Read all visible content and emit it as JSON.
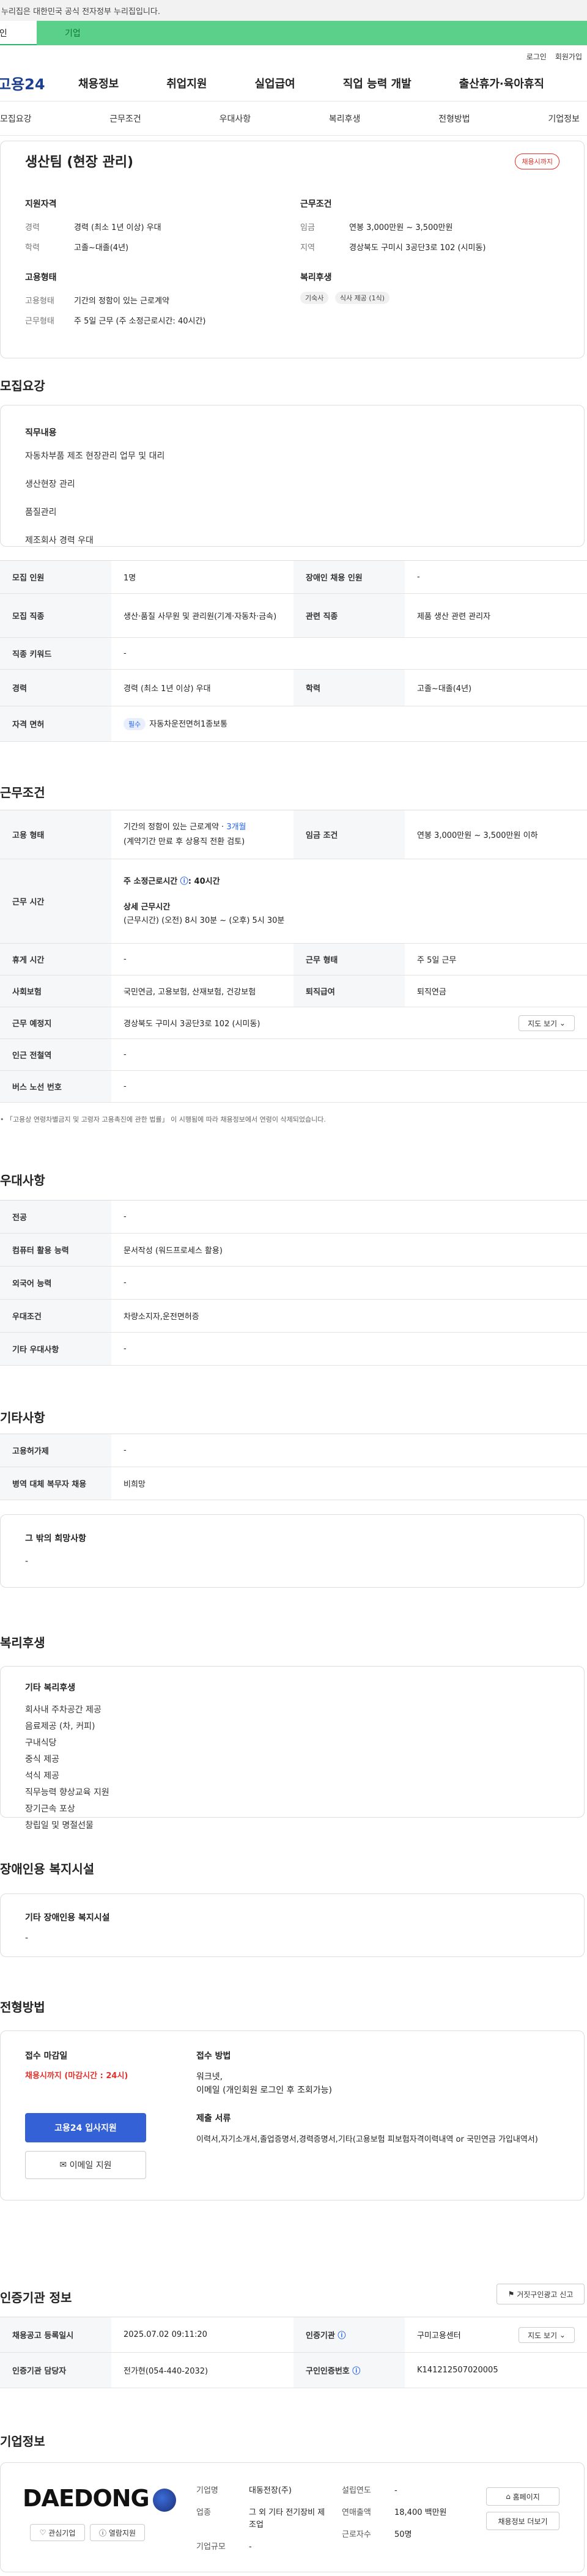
{
  "gov_banner": "이 누리집은 대한민국 공식 전자정부 누리집입니다.",
  "type_tabs": [
    "개인",
    "기업"
  ],
  "top_links": [
    "로그인",
    "회원가입"
  ],
  "gnb": {
    "logo": "고용24",
    "menu": [
      "채용정보",
      "취업지원",
      "실업급여",
      "직업 능력 개발",
      "출산휴가·육아휴직"
    ]
  },
  "subnav": [
    "모집요강",
    "근무조건",
    "우대사항",
    "복리후생",
    "전형방법",
    "기업정보"
  ],
  "summary": {
    "title": "생산팀 (현장 관리)",
    "deadline_badge": "채용시까지",
    "qual_head": "지원자격",
    "career_k": "경력",
    "career_v": "경력 (최소 1년 이상) 우대",
    "edu_k": "학력",
    "edu_v": "고졸~대졸(4년)",
    "emp_head": "고용형태",
    "emptype_k": "고용형태",
    "emptype_v": "기간의 정함이 있는 근로계약",
    "worktype_k": "근무형태",
    "worktype_v": "주 5일 근무 (주 소정근로시간: 40시간)",
    "cond_head": "근무조건",
    "wage_k": "임금",
    "wage_v": "연봉 3,000만원 ~ 3,500만원",
    "area_k": "지역",
    "area_v": "경상북도 구미시 3공단3로 102 (시미동)",
    "welfare_head": "복리후생",
    "welfare_tags": [
      "기숙사",
      "식사 제공 (1식)"
    ]
  },
  "recruit": {
    "heading": "모집요강",
    "duty_label": "직무내용",
    "duties": [
      "자동차부품 제조 현장관리 업무 및 대리",
      "생산현장 관리",
      "품질관리",
      "제조회사 경력 우대"
    ],
    "table": [
      {
        "k1": "모집 인원",
        "v1": "1명",
        "k2": "장애인 채용 인원",
        "v2": "-"
      },
      {
        "k1": "모집 직종",
        "v1": "생산·품질 사무원 및 관리원(기계·자동차·금속)",
        "k2": "관련 직종",
        "v2": "제품 생산 관련 관리자"
      },
      {
        "k1": "직종 키워드",
        "v1": "-"
      },
      {
        "k1": "경력",
        "v1": "경력 (최소 1년 이상) 우대",
        "k2": "학력",
        "v2": "고졸~대졸(4년)"
      },
      {
        "k1": "자격 면허",
        "v1": "자동차운전면허1종보통",
        "tag": "필수"
      }
    ]
  },
  "work": {
    "heading": "근무조건",
    "emp_k": "고용 형태",
    "emp_v1": "기간의 정함이 있는 근로계약 · ",
    "emp_v1b": "3개월",
    "emp_v2": "(계약기간 만료 후 상용직 전환 검토)",
    "wage_k": "임금 조건",
    "wage_v": "연봉 3,000만원 ~ 3,500만원 이하",
    "time_k": "근무 시간",
    "time_main": "주 소정근로시간 ",
    "time_main2": ": 40시간",
    "time_detail_label": "상세 근무시간",
    "time_detail": "(근무시간) (오전) 8시 30분 ~ (오후) 5시 30분",
    "rest_k": "휴게 시간",
    "rest_v": "-",
    "form_k": "근무 형태",
    "form_v": "주 5일 근무",
    "ins_k": "사회보험",
    "ins_v": "국민연금, 고용보험, 산재보험, 건강보험",
    "ret_k": "퇴직급여",
    "ret_v": "퇴직연금",
    "loc_k": "근무 예정지",
    "loc_v": "경상북도 구미시 3공단3로 102 (시미동)",
    "map_btn": "지도 보기",
    "subway_k": "인근 전철역",
    "subway_v": "-",
    "bus_k": "버스 노선 번호",
    "bus_v": "-",
    "notice": "「고용상 연령차별금지 및 고령자 고용촉진에 관한 법률」 이 시행됨에 따라 채용정보에서 연령이 삭제되었습니다."
  },
  "pref": {
    "heading": "우대사항",
    "rows": [
      {
        "k": "전공",
        "v": "-"
      },
      {
        "k": "컴퓨터 활용 능력",
        "v": "문서작성 (워드프로세스 활용)"
      },
      {
        "k": "외국어 능력",
        "v": "-"
      },
      {
        "k": "우대조건",
        "v": "차량소지자,운전면허증"
      },
      {
        "k": "기타 우대사항",
        "v": "-"
      }
    ]
  },
  "etc": {
    "heading": "기타사항",
    "rows": [
      {
        "k": "고용허가제",
        "v": "-"
      },
      {
        "k": "병역 대체 복무자 채용",
        "v": "비희망"
      }
    ],
    "box_title": "그 밖의 희망사항",
    "box_value": "-"
  },
  "welfare": {
    "heading": "복리후생",
    "box_title": "기타 복리후생",
    "items": [
      "회사내 주차공간 제공",
      "음료제공 (차, 커피)",
      "구내식당",
      "중식 제공",
      "석식 제공",
      "직무능력 향상교육 지원",
      "장기근속 포상",
      "창립일 및 명절선물"
    ]
  },
  "disabled": {
    "heading": "장애인용 복지시설",
    "box_title": "기타 장애인용 복지시설",
    "box_value": "-"
  },
  "process": {
    "heading": "전형방법",
    "deadline_label": "접수 마감일",
    "deadline_value": "채용시까지 (마감시간 : 24시)",
    "apply_btn": "고용24 입사지원",
    "email_btn": "이메일 지원",
    "method_label": "접수 방법",
    "methods": [
      "워크넷,",
      "이메일 (개인회원 로그인 후 조회가능)"
    ],
    "docs_label": "제출 서류",
    "docs": "이력서,자기소개서,졸업증명서,경력증명서,기타(고용보험 피보험자격이력내역 or 국민연금 가입내역서)"
  },
  "auth": {
    "heading": "인증기관 정보",
    "report_btn": "거짓구인광고 신고",
    "reg_k": "채용공고 등록일시",
    "reg_v": "2025.07.02 09:11:20",
    "org_k": "인증기관",
    "org_v": "구미고용센터",
    "map_btn": "지도 보기",
    "mgr_k": "인증기관 담당자",
    "mgr_v": "전가현(054-440-2032)",
    "num_k": "구인인증번호",
    "num_v": "K141212507020005"
  },
  "company": {
    "heading": "기업정보",
    "logo_text": "DAEDONG",
    "interest_btn": "관심기업",
    "jobs_btn": "열람지원",
    "name_k": "기업명",
    "name_v": "대동전장(주)",
    "ind_k": "업종",
    "ind_v": "그 외 기타 전기장비 제조업",
    "size_k": "기업규모",
    "size_v": "-",
    "year_k": "설립연도",
    "year_v": "-",
    "sales_k": "연매출액",
    "sales_v": "18,400 백만원",
    "emp_k": "근로자수",
    "emp_v": "50명",
    "home_btn": "홈페이지",
    "list_btn": "채용정보 더보기"
  }
}
